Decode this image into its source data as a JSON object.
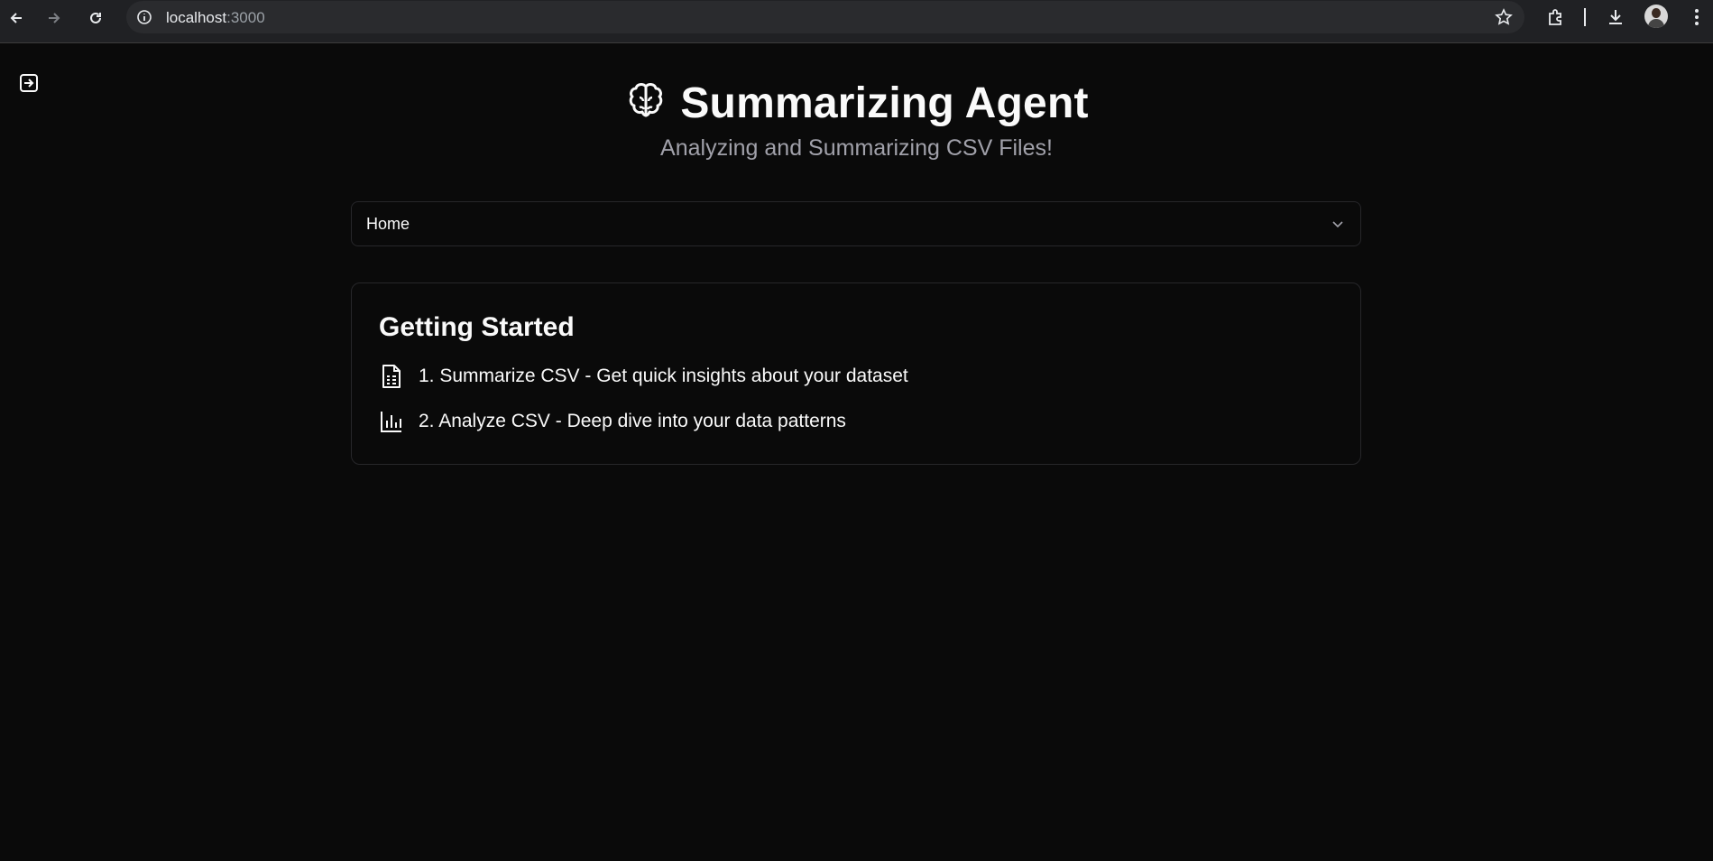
{
  "browser": {
    "url_host": "localhost",
    "url_port": ":3000"
  },
  "app": {
    "title": "Summarizing Agent",
    "subtitle": "Analyzing and Summarizing CSV Files!",
    "select": {
      "value": "Home"
    },
    "card": {
      "heading": "Getting Started",
      "items": [
        {
          "icon": "file-spreadsheet-icon",
          "text": "1. Summarize CSV - Get quick insights about your dataset"
        },
        {
          "icon": "bar-chart-icon",
          "text": "2. Analyze CSV - Deep dive into your data patterns"
        }
      ]
    }
  },
  "colors": {
    "background": "#0a0a0a",
    "border": "#27272a",
    "muted_text": "#a1a1aa",
    "text": "#fafafa"
  }
}
